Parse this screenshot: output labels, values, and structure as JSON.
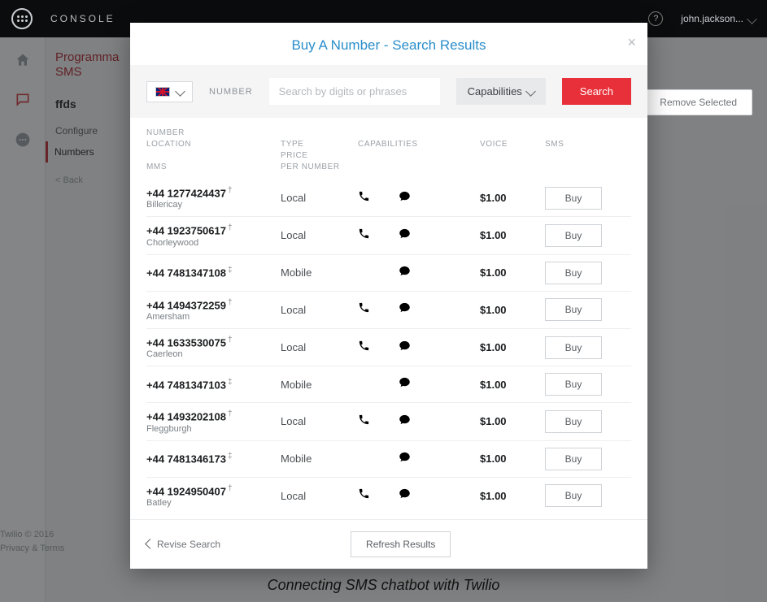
{
  "topbar": {
    "brand": "CONSOLE",
    "user": "john.jackson..."
  },
  "sidebar": {
    "product1": "Programma",
    "product2": "SMS",
    "heading": "ffds",
    "items": [
      "Configure",
      "Numbers"
    ],
    "back": "< Back",
    "copyright": "Twilio © 2016",
    "privacy": "Privacy & Terms"
  },
  "background_button": "Remove Selected",
  "modal": {
    "title": "Buy A Number - Search Results",
    "country_code": "GB",
    "number_lbl": "NUMBER",
    "search_placeholder": "Search by digits or phrases",
    "capabilities_btn": "Capabilities",
    "search_btn": "Search",
    "headers": {
      "number": "NUMBER",
      "location": "LOCATION",
      "type": "TYPE",
      "capabilities": "CAPABILITIES",
      "voice": "VOICE",
      "sms": "SMS",
      "mms": "MMS",
      "price": "PRICE",
      "per_number": "PER NUMBER"
    },
    "buy_label": "Buy",
    "rows": [
      {
        "number": "+44  1277424437",
        "sup": "†",
        "location": "Billericay",
        "type": "Local",
        "voice": true,
        "sms": true,
        "mms": false,
        "price": "$1.00"
      },
      {
        "number": "+44  1923750617",
        "sup": "†",
        "location": "Chorleywood",
        "type": "Local",
        "voice": true,
        "sms": true,
        "mms": false,
        "price": "$1.00"
      },
      {
        "number": "+44  7481347108",
        "sup": "‡",
        "location": "",
        "type": "Mobile",
        "voice": false,
        "sms": true,
        "mms": false,
        "price": "$1.00"
      },
      {
        "number": "+44  1494372259",
        "sup": "†",
        "location": "Amersham",
        "type": "Local",
        "voice": true,
        "sms": true,
        "mms": false,
        "price": "$1.00"
      },
      {
        "number": "+44  1633530075",
        "sup": "†",
        "location": "Caerleon",
        "type": "Local",
        "voice": true,
        "sms": true,
        "mms": false,
        "price": "$1.00"
      },
      {
        "number": "+44  7481347103",
        "sup": "‡",
        "location": "",
        "type": "Mobile",
        "voice": false,
        "sms": true,
        "mms": false,
        "price": "$1.00"
      },
      {
        "number": "+44  1493202108",
        "sup": "†",
        "location": "Fleggburgh",
        "type": "Local",
        "voice": true,
        "sms": true,
        "mms": false,
        "price": "$1.00"
      },
      {
        "number": "+44  7481346173",
        "sup": "‡",
        "location": "",
        "type": "Mobile",
        "voice": false,
        "sms": true,
        "mms": false,
        "price": "$1.00"
      },
      {
        "number": "+44  1924950407",
        "sup": "†",
        "location": "Batley",
        "type": "Local",
        "voice": true,
        "sms": true,
        "mms": false,
        "price": "$1.00"
      }
    ],
    "revise": "Revise Search",
    "refresh": "Refresh Results"
  },
  "caption": "Connecting SMS chatbot with Twilio"
}
